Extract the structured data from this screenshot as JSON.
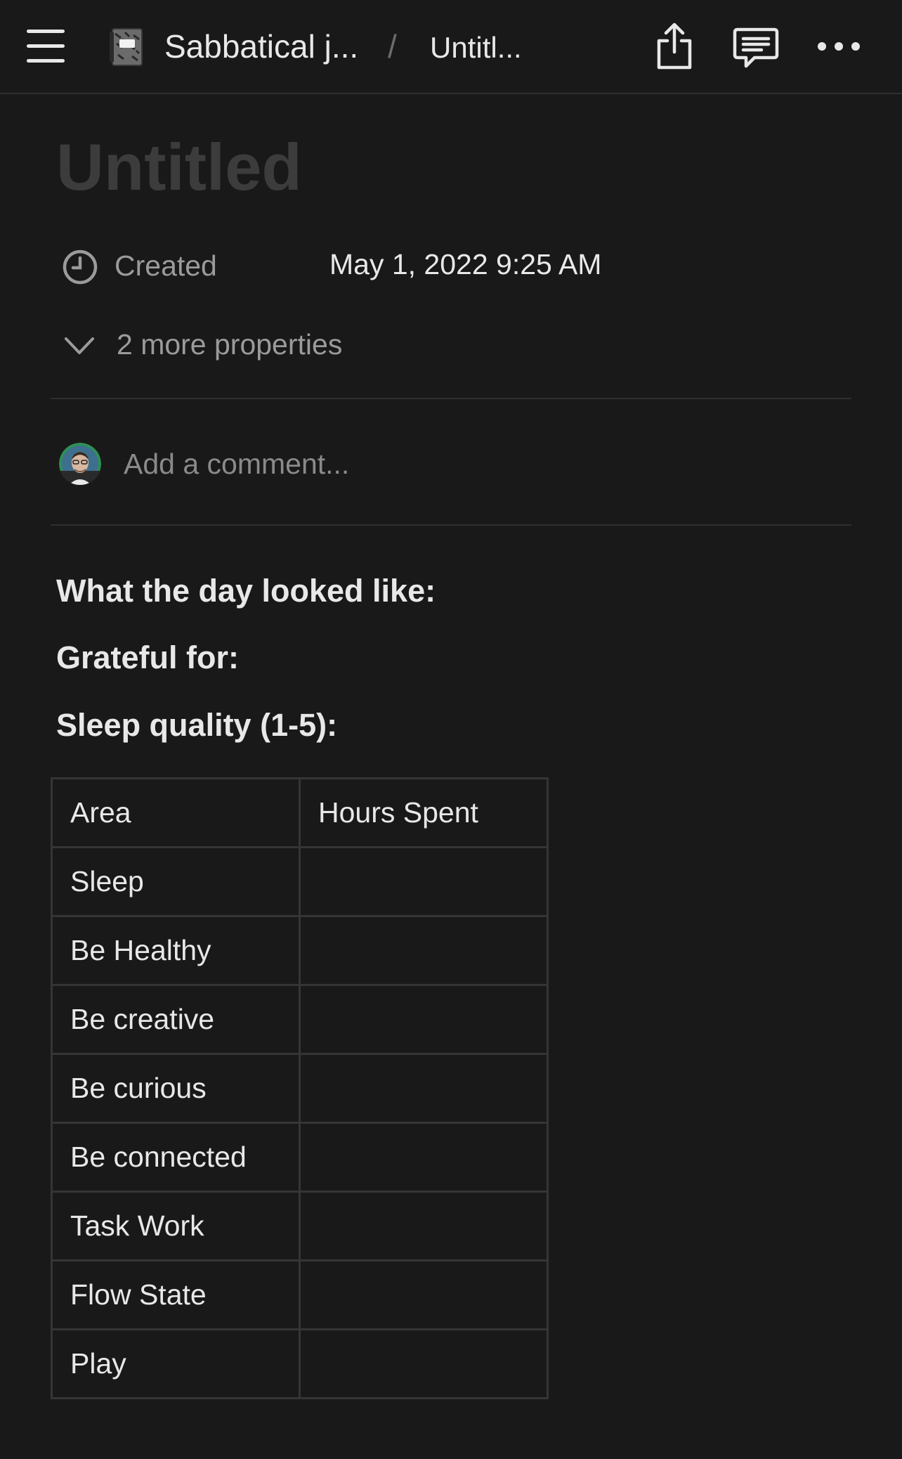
{
  "topbar": {
    "breadcrumb_root": "Sabbatical j...",
    "separator": "/",
    "breadcrumb_current": "Untitl...",
    "icons": {
      "menu": "hamburger-menu-icon",
      "page": "notebook-icon",
      "share": "share-icon",
      "comments": "comment-icon",
      "more": "more-horizontal-icon"
    }
  },
  "page": {
    "title": "Untitled",
    "property": {
      "icon": "clock-icon",
      "name": "Created",
      "value": "May 1, 2022 9:25 AM"
    },
    "more_properties": "2 more properties",
    "comment": {
      "placeholder": "Add a comment..."
    },
    "headings": [
      "What the day looked like:",
      "Grateful for:",
      "Sleep quality (1-5):"
    ],
    "table": {
      "headers": [
        "Area",
        "Hours Spent"
      ],
      "rows": [
        [
          "Sleep",
          ""
        ],
        [
          "Be Healthy",
          ""
        ],
        [
          "Be creative",
          ""
        ],
        [
          "Be curious",
          ""
        ],
        [
          "Be connected",
          ""
        ],
        [
          "Task Work",
          ""
        ],
        [
          "Flow State",
          ""
        ],
        [
          "Play",
          ""
        ]
      ]
    }
  },
  "colors": {
    "background": "#191919",
    "text": "#e8e8e8",
    "muted": "#9b9b9b",
    "title_placeholder": "#3c3c3c",
    "border": "#353535"
  }
}
